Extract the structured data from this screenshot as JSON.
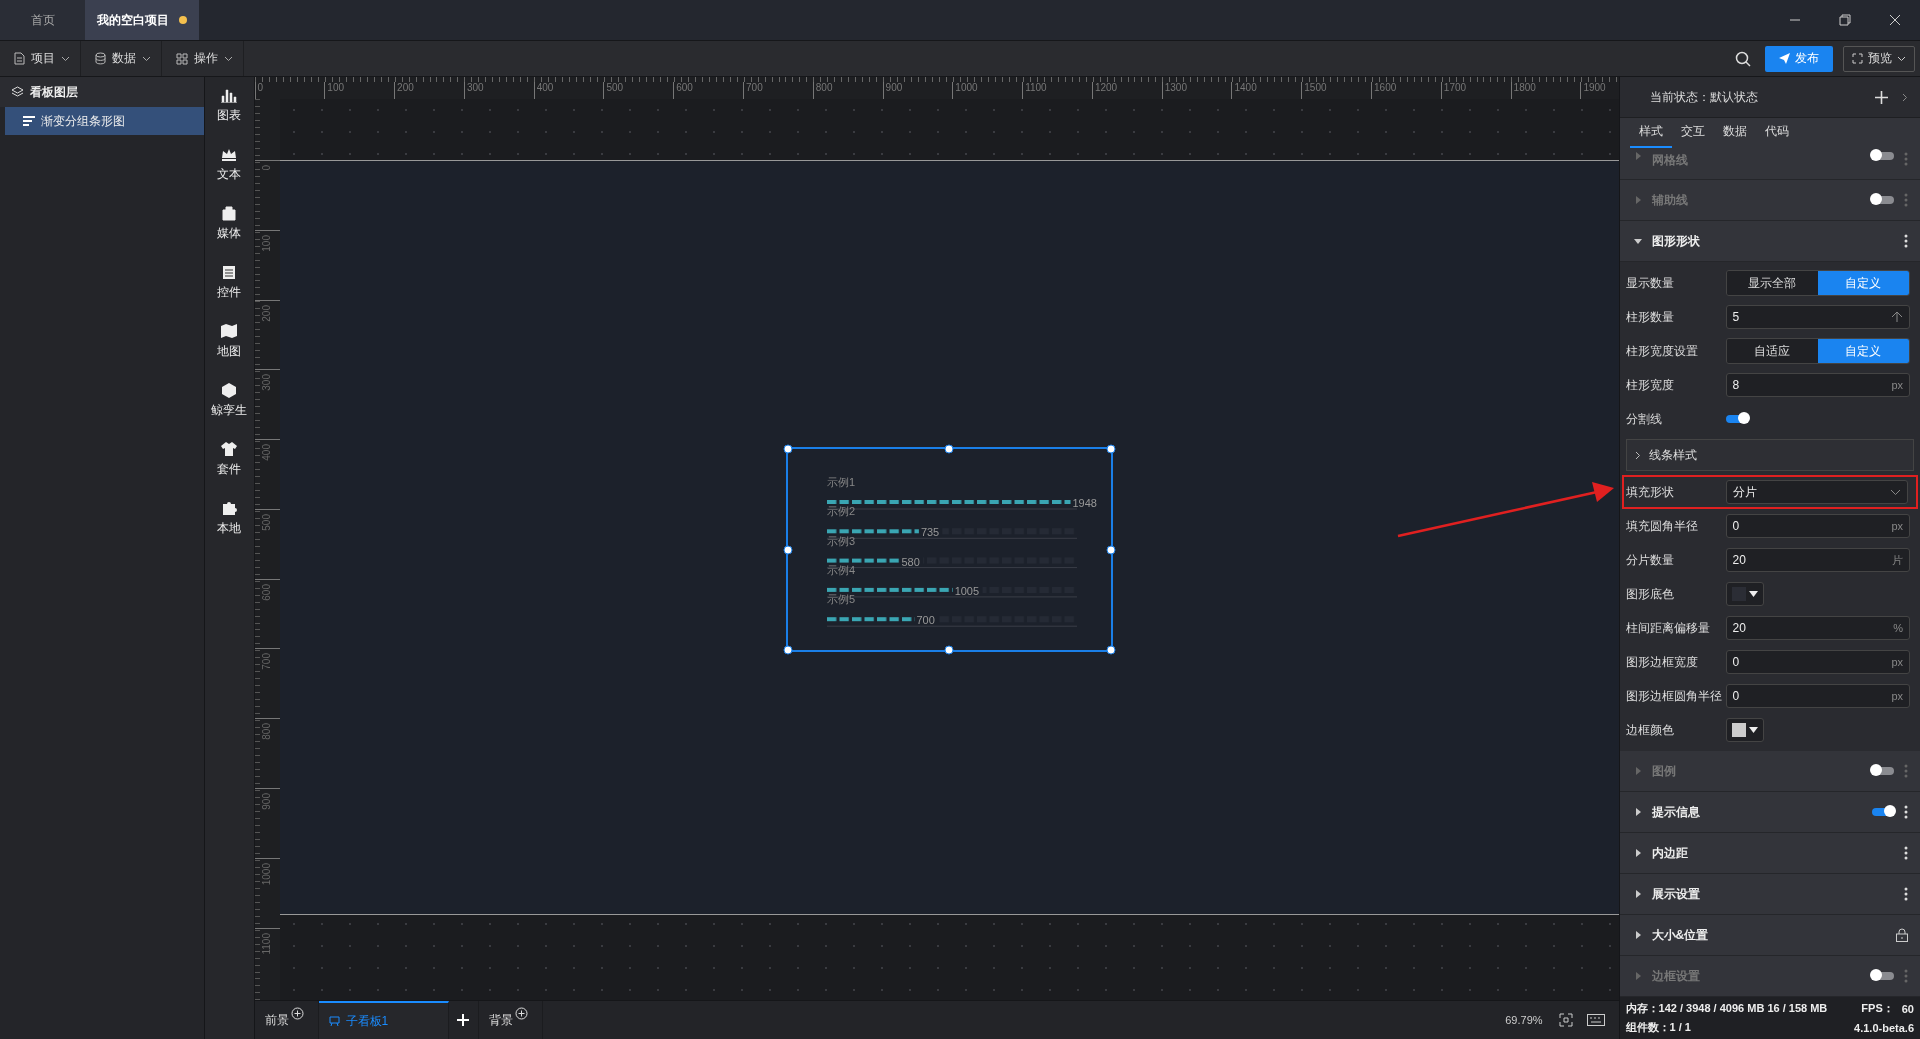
{
  "tabs": [
    {
      "label": "首页",
      "selected": false,
      "modified": false
    },
    {
      "label": "我的空白项目",
      "selected": true,
      "modified": true
    }
  ],
  "menus": [
    {
      "label": "项目"
    },
    {
      "label": "数据"
    },
    {
      "label": "操作"
    }
  ],
  "actions": {
    "publish": "发布",
    "preview": "预览"
  },
  "layers": {
    "title": "看板图层",
    "items": [
      {
        "label": "渐变分组条形图",
        "selected": true
      }
    ]
  },
  "library": [
    {
      "label": "图表"
    },
    {
      "label": "文本"
    },
    {
      "label": "媒体"
    },
    {
      "label": "控件"
    },
    {
      "label": "地图"
    },
    {
      "label": "鲸孪生"
    },
    {
      "label": "套件"
    },
    {
      "label": "本地"
    }
  ],
  "ruler": {
    "x_labels": [
      "0",
      "100",
      "200",
      "300",
      "400",
      "500",
      "600",
      "700",
      "800",
      "900",
      "1000",
      "1100",
      "1200",
      "1300",
      "1400",
      "1500",
      "1600",
      "1700",
      "1800",
      "1900"
    ],
    "y_labels": [
      "0",
      "100",
      "200",
      "300",
      "400",
      "500",
      "600",
      "700",
      "800",
      "900",
      "1000",
      "1100"
    ]
  },
  "component": {
    "selected": true,
    "chart_data": {
      "type": "bar",
      "orientation": "horizontal",
      "categories": [
        "示例1",
        "示例2",
        "示例3",
        "示例4",
        "示例5"
      ],
      "values": [
        1948,
        735,
        580,
        1005,
        700
      ],
      "data_labels": true
    }
  },
  "bottom_tabs": [
    {
      "label": "前景",
      "kind": "layer",
      "selected": false
    },
    {
      "label": "子看板1",
      "kind": "board",
      "selected": true
    },
    {
      "label": "背景",
      "kind": "layer",
      "selected": false
    }
  ],
  "zoom": "69.79%",
  "inspector": {
    "state_label": "当前状态：默认状态",
    "tabs": [
      {
        "label": "样式",
        "selected": true
      },
      {
        "label": "交互",
        "selected": false
      },
      {
        "label": "数据",
        "selected": false
      },
      {
        "label": "代码",
        "selected": false
      }
    ],
    "sections": [
      {
        "title": "网格线",
        "expanded": false,
        "toggle": false,
        "menu": true,
        "locked": false
      },
      {
        "title": "辅助线",
        "expanded": false,
        "toggle": false,
        "menu": true,
        "locked": false
      },
      {
        "title": "图形形状",
        "expanded": true,
        "menu": true,
        "locked": false,
        "fields": [
          {
            "label": "显示数量",
            "kind": "segmented",
            "options": [
              {
                "label": "显示全部",
                "selected": false
              },
              {
                "label": "自定义",
                "selected": true
              }
            ]
          },
          {
            "label": "柱形数量",
            "kind": "stepper",
            "value": "5"
          },
          {
            "label": "柱形宽度设置",
            "kind": "segmented",
            "options": [
              {
                "label": "自适应",
                "selected": false
              },
              {
                "label": "自定义",
                "selected": true
              }
            ]
          },
          {
            "label": "柱形宽度",
            "kind": "number",
            "value": "8",
            "unit": "px"
          },
          {
            "label": "分割线",
            "kind": "switch",
            "on": true
          },
          {
            "label": "线条样式",
            "kind": "group",
            "expanded": false
          },
          {
            "label": "填充形状",
            "kind": "select",
            "value": "分片",
            "highlighted": true
          },
          {
            "label": "填充圆角半径",
            "kind": "number",
            "value": "0",
            "unit": "px"
          },
          {
            "label": "分片数量",
            "kind": "number",
            "value": "20",
            "unit": "片"
          },
          {
            "label": "图形底色",
            "kind": "color",
            "color": "#2b2d35"
          },
          {
            "label": "柱间距离偏移量",
            "kind": "number",
            "value": "20",
            "unit": "%"
          },
          {
            "label": "图形边框宽度",
            "kind": "number",
            "value": "0",
            "unit": "px"
          },
          {
            "label": "图形边框圆角半径",
            "kind": "number",
            "value": "0",
            "unit": "px"
          },
          {
            "label": "边框颜色",
            "kind": "color",
            "color": "#cccccc"
          }
        ]
      },
      {
        "title": "图例",
        "expanded": false,
        "toggle": false,
        "menu": true,
        "locked": false
      },
      {
        "title": "提示信息",
        "expanded": false,
        "toggle": true,
        "menu": true,
        "locked": false
      },
      {
        "title": "内边距",
        "expanded": false,
        "menu": true,
        "locked": false
      },
      {
        "title": "展示设置",
        "expanded": false,
        "menu": true,
        "locked": false
      },
      {
        "title": "大小&位置",
        "expanded": false,
        "menu": false,
        "locked": true
      },
      {
        "title": "边框设置",
        "expanded": false,
        "toggle": false,
        "menu": true,
        "locked": false
      }
    ]
  },
  "status": {
    "memory_label": "内存：",
    "memory": "142 / 3948 / 4096 MB  16 / 158 MB",
    "fps_label": "FPS：",
    "fps": "60",
    "components": "组件数：1 / 1",
    "version": "4.1.0-beta.6"
  }
}
